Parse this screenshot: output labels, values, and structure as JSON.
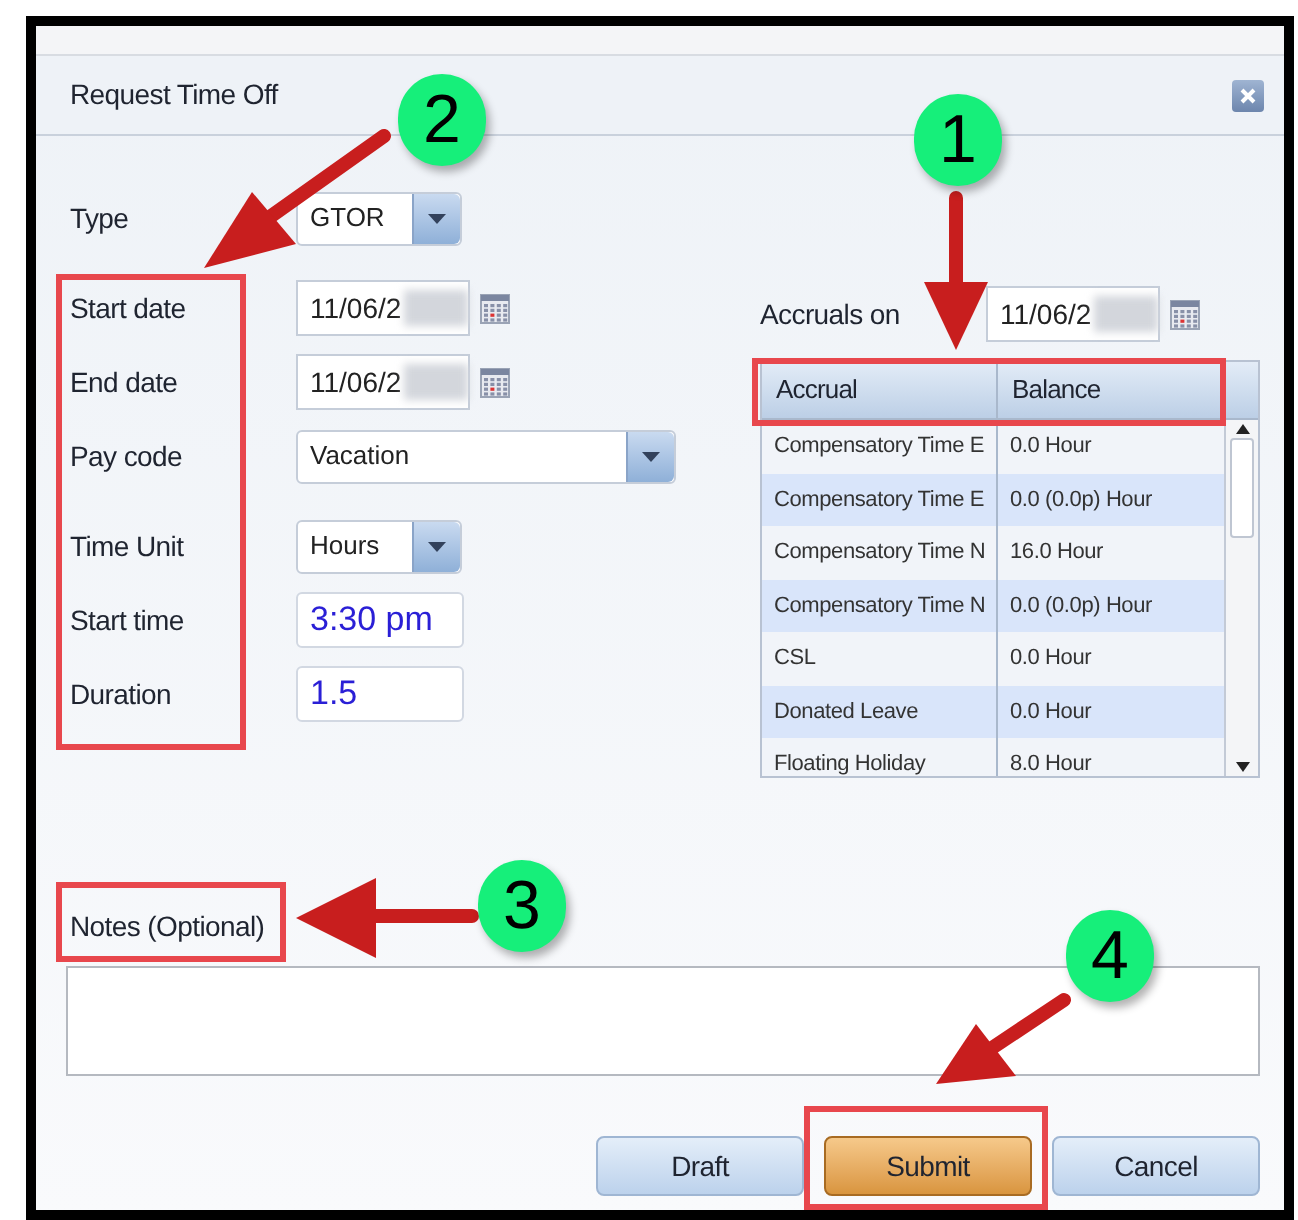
{
  "window": {
    "title": "Request Time Off"
  },
  "fields": [
    {
      "label": "Type",
      "kind": "dropdown",
      "value": "GTOR"
    },
    {
      "label": "Start date",
      "kind": "date",
      "value": "11/06/2"
    },
    {
      "label": "End date",
      "kind": "date",
      "value": "11/06/2"
    },
    {
      "label": "Pay code",
      "kind": "dropdown",
      "value": "Vacation"
    },
    {
      "label": "Time Unit",
      "kind": "dropdown",
      "value": "Hours"
    },
    {
      "label": "Start time",
      "kind": "text",
      "value": "3:30 pm"
    },
    {
      "label": "Duration",
      "kind": "text",
      "value": "1.5"
    }
  ],
  "accruals": {
    "label": "Accruals on",
    "date": "11/06/2",
    "table": {
      "columns": [
        "Accrual",
        "Balance"
      ],
      "rows": [
        [
          "Compensatory Time E",
          "0.0 Hour"
        ],
        [
          "Compensatory Time E",
          "0.0 (0.0p) Hour"
        ],
        [
          "Compensatory Time N",
          "16.0 Hour"
        ],
        [
          "Compensatory Time N",
          "0.0 (0.0p) Hour"
        ],
        [
          "CSL",
          "0.0 Hour"
        ],
        [
          "Donated Leave",
          "0.0 Hour"
        ],
        [
          "Floating Holiday",
          "8.0 Hour"
        ]
      ]
    }
  },
  "notes": {
    "label": "Notes (Optional)"
  },
  "buttons": [
    {
      "label": "Draft",
      "kind": "plain"
    },
    {
      "label": "Submit",
      "kind": "primary"
    },
    {
      "label": "Cancel",
      "kind": "plain"
    }
  ],
  "annotations": [
    {
      "number": "1"
    },
    {
      "number": "2"
    },
    {
      "number": "3"
    },
    {
      "number": "4"
    }
  ]
}
